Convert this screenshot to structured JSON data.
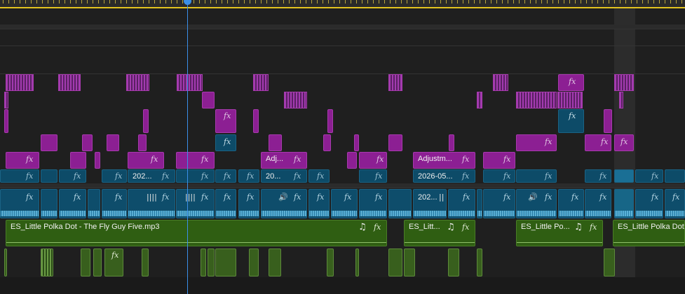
{
  "colors": {
    "video": "#8c1f93",
    "adjustment": "#0d4b68",
    "audio": "#2f5e12",
    "playhead": "#3a8fe8",
    "ruler": "#e3c320"
  },
  "fx_label": "fx",
  "clips": {
    "adj_a": "202...",
    "adj_b": "20...",
    "adj_c": "Adj...",
    "adj_d": "Adjustm...",
    "adj_e": "2026-05...",
    "adj_f": "202...",
    "music_1": "ES_Little Polka Dot - The Fly Guy Five.mp3",
    "music_2": "ES_Litt...",
    "music_3": "ES_Little Po...",
    "music_4": "ES_Little Polka Dot -"
  },
  "icons": [
    "music-note-icon",
    "waveform-icon",
    "speaker-icon",
    "fx-icon"
  ]
}
